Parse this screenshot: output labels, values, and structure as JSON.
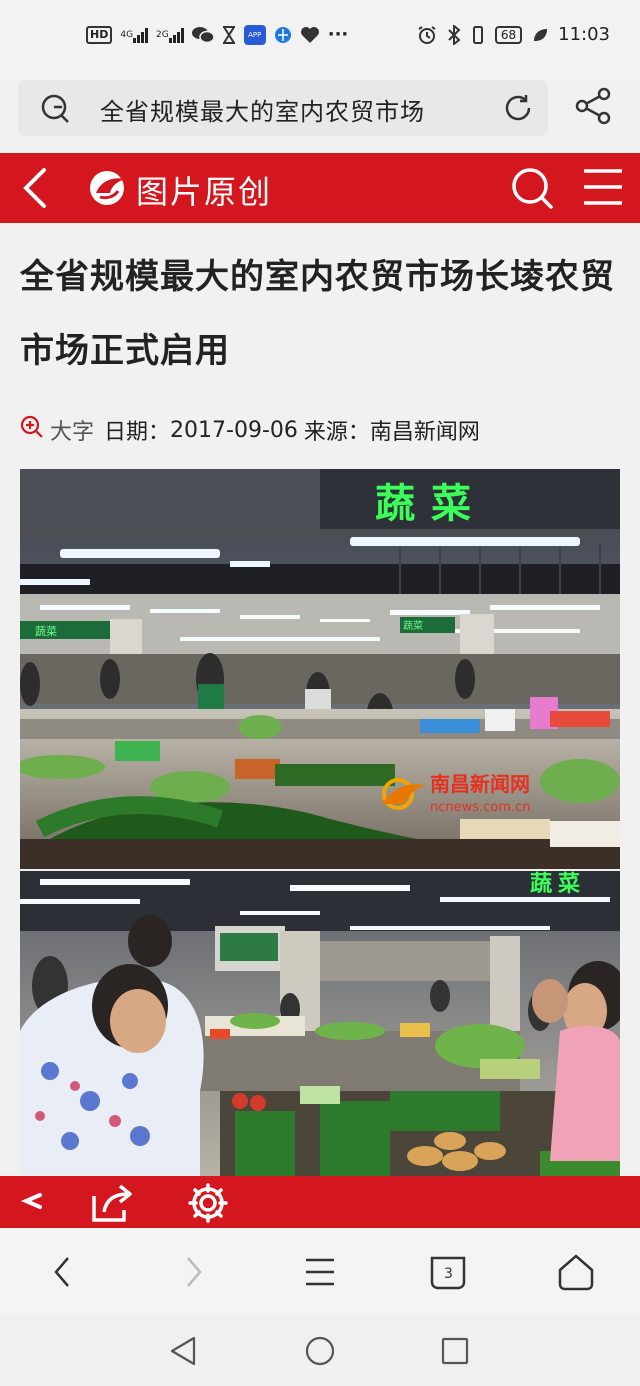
{
  "status_bar": {
    "left_icons": [
      "hd-icon",
      "signal-4g-icon",
      "signal-2g-icon",
      "wechat-icon",
      "hourglass-icon",
      "app-icon",
      "browser-icon",
      "heart-icon",
      "more-icon"
    ],
    "signal1_label": "4G",
    "signal2_label": "2G",
    "hd_label": "HD",
    "more_label": "···",
    "battery_level": "68",
    "time": "11:03"
  },
  "url_bar": {
    "query": "全省规模最大的室内农贸市场"
  },
  "header": {
    "title": "图片原创"
  },
  "article": {
    "title": "全省规模最大的室内农贸市场长堎农贸市场正式启用",
    "font_size_label": "大字",
    "date_label": "日期：",
    "date": "2017-09-06",
    "source_label": "来源：",
    "source": "南昌新闻网"
  },
  "photo1": {
    "sign_text": "蔬菜",
    "watermark_cn": "南昌新闻网",
    "watermark_en": "ncnews.com.cn"
  },
  "photo2": {
    "sign_text": "蔬菜"
  },
  "browser_nav": {
    "tab_count": "3"
  },
  "colors": {
    "brand_red": "#d4161f",
    "neon_green": "#3cff5a"
  }
}
